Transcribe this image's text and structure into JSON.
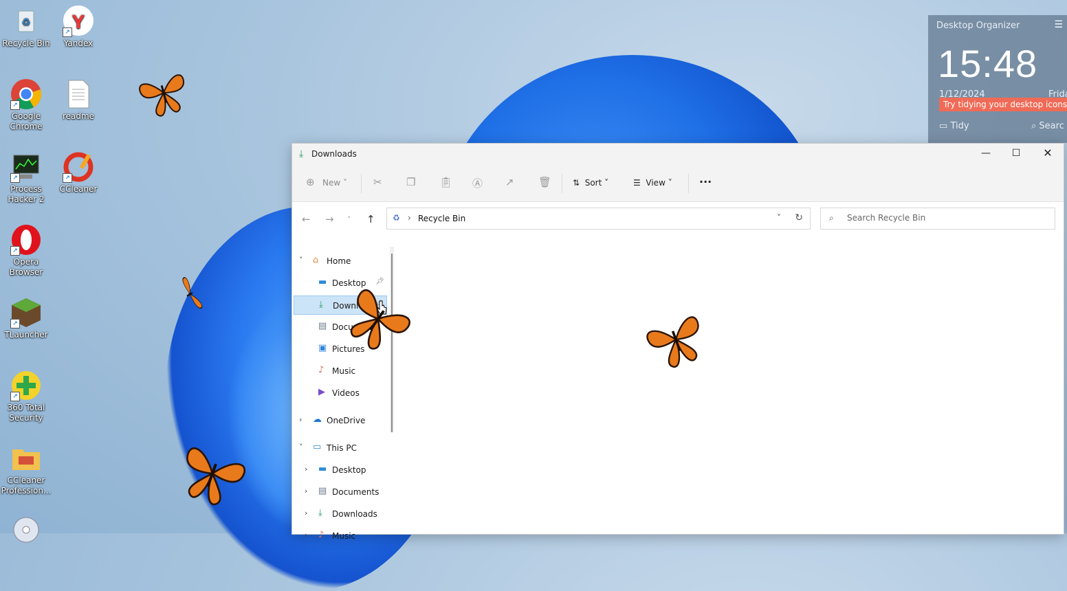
{
  "desktop": {
    "icons": [
      {
        "label": "Recycle Bin",
        "icon": "recycle-bin-icon"
      },
      {
        "label": "Yandex",
        "icon": "yandex-icon"
      },
      {
        "label": "Google Chrome",
        "icon": "chrome-icon"
      },
      {
        "label": "readme",
        "icon": "text-file-icon"
      },
      {
        "label": "Process Hacker 2",
        "icon": "process-hacker-icon"
      },
      {
        "label": "CCleaner",
        "icon": "ccleaner-icon"
      },
      {
        "label": "Opera Browser",
        "icon": "opera-icon"
      },
      {
        "label": "TLauncher",
        "icon": "tlauncher-icon"
      },
      {
        "label": "360 Total Security",
        "icon": "360-security-icon"
      },
      {
        "label": "CCleaner Profession...",
        "icon": "ccleaner-pro-icon"
      }
    ]
  },
  "organizer": {
    "title": "Desktop Organizer",
    "time": "15:48",
    "date": "1/12/2024",
    "day": "Frida",
    "tip": "Try tidying your desktop icons",
    "tidy": "Tidy",
    "search": "Searc"
  },
  "window": {
    "title": "Downloads",
    "toolbar": {
      "new": "New",
      "sort": "Sort",
      "view": "View",
      "more": "···"
    },
    "address": {
      "crumb": "Recycle Bin"
    },
    "search": {
      "placeholder": "Search Recycle Bin"
    },
    "nav": {
      "home": "Home",
      "quick": [
        "Desktop",
        "Downloads",
        "Documents",
        "Pictures",
        "Music",
        "Videos"
      ],
      "onedrive": "OneDrive",
      "thispc": "This PC",
      "pc": [
        "Desktop",
        "Documents",
        "Downloads",
        "Music"
      ]
    }
  },
  "colors": {
    "accent": "#0067c0",
    "selected": "#cce4f7",
    "tip": "#f06b57"
  }
}
